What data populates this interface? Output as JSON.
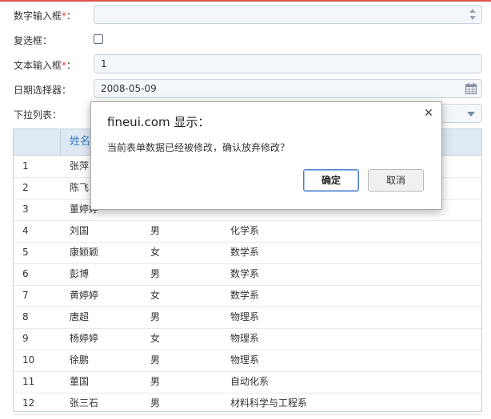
{
  "form": {
    "number_label": "数字输入框",
    "required_mark": "*",
    "label_colon": "：",
    "checkbox_label": "复选框：",
    "text_label": "文本输入框",
    "text_value": "1",
    "date_label": "日期选择器：",
    "date_value": "2008-05-09",
    "dropdown_label": "下拉列表："
  },
  "grid": {
    "columns": [
      "姓名"
    ],
    "rows": [
      {
        "idx": "1",
        "name": "张萍",
        "sex": "",
        "major": ""
      },
      {
        "idx": "2",
        "name": "陈飞",
        "sex": "",
        "major": ""
      },
      {
        "idx": "3",
        "name": "董婷婷",
        "sex": "",
        "major": ""
      },
      {
        "idx": "4",
        "name": "刘国",
        "sex": "男",
        "major": "化学系"
      },
      {
        "idx": "5",
        "name": "康颖颖",
        "sex": "女",
        "major": "数学系"
      },
      {
        "idx": "6",
        "name": "彭博",
        "sex": "男",
        "major": "数学系"
      },
      {
        "idx": "7",
        "name": "黄婷婷",
        "sex": "女",
        "major": "数学系"
      },
      {
        "idx": "8",
        "name": "唐超",
        "sex": "男",
        "major": "物理系"
      },
      {
        "idx": "9",
        "name": "杨婷婷",
        "sex": "女",
        "major": "物理系"
      },
      {
        "idx": "10",
        "name": "徐鹏",
        "sex": "男",
        "major": "物理系"
      },
      {
        "idx": "11",
        "name": "董国",
        "sex": "男",
        "major": "自动化系"
      },
      {
        "idx": "12",
        "name": "张三石",
        "sex": "男",
        "major": "材料科学与工程系"
      }
    ]
  },
  "dialog": {
    "title": "fineui.com 显示：",
    "message": "当前表单数据已经被修改，确认放弃修改？",
    "ok_label": "确定",
    "cancel_label": "取消",
    "close_icon": "close-icon"
  },
  "colors": {
    "accent": "#3a7bc8",
    "required": "#e4393c",
    "top_line": "#d9534f"
  }
}
